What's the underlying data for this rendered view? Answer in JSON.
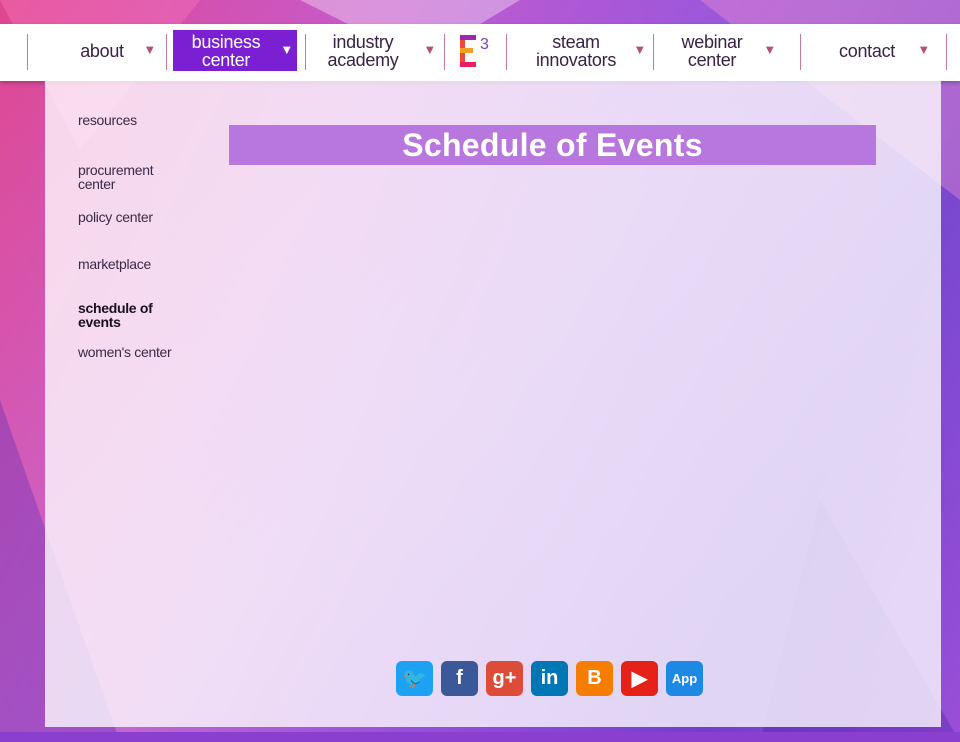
{
  "nav": {
    "items": [
      {
        "label1": "about",
        "label2": "",
        "active": false
      },
      {
        "label1": "business",
        "label2": "center",
        "active": true
      },
      {
        "label1": "industry",
        "label2": "academy",
        "active": false
      },
      {
        "label1": "steam",
        "label2": "innovators",
        "active": false
      },
      {
        "label1": "webinar",
        "label2": "center",
        "active": false
      },
      {
        "label1": "contact",
        "label2": "",
        "active": false
      }
    ],
    "arrow": "▼",
    "logo_text": "3"
  },
  "sidebar": {
    "items": [
      {
        "label": "resources"
      },
      {
        "label": "procurement center"
      },
      {
        "label": "policy center"
      },
      {
        "label": "marketplace"
      },
      {
        "label": "schedule of events"
      },
      {
        "label": "women's center"
      }
    ]
  },
  "main": {
    "title": "Schedule of Events"
  },
  "social": {
    "items": [
      {
        "name": "twitter-icon",
        "glyph": "🐦",
        "color": "#1da1f2"
      },
      {
        "name": "facebook-icon",
        "glyph": "f",
        "color": "#3b5998"
      },
      {
        "name": "google-plus-icon",
        "glyph": "g+",
        "color": "#dd4b39"
      },
      {
        "name": "linkedin-icon",
        "glyph": "in",
        "color": "#0077b5"
      },
      {
        "name": "blogger-icon",
        "glyph": "B",
        "color": "#f57d00"
      },
      {
        "name": "youtube-icon",
        "glyph": "▶",
        "color": "#e62117"
      },
      {
        "name": "app-icon",
        "glyph": "App",
        "color": "#1e88e5"
      }
    ]
  }
}
